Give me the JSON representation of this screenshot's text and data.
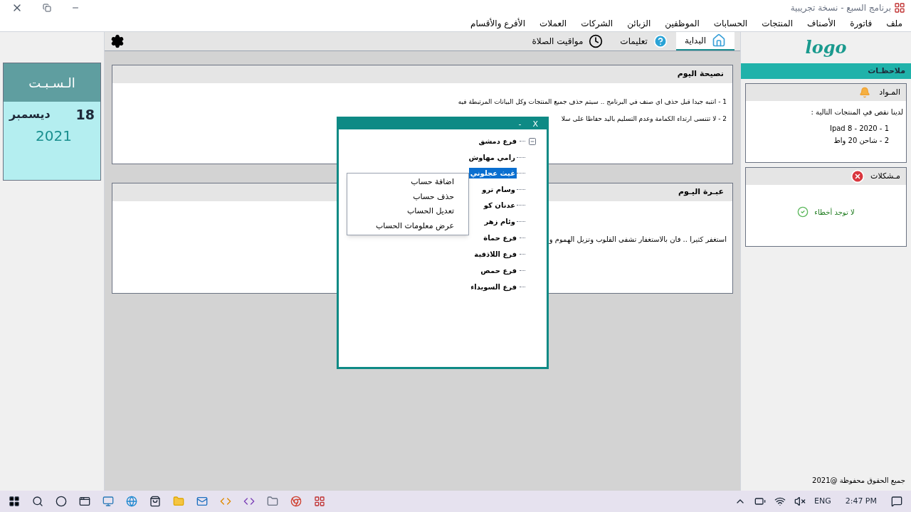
{
  "window": {
    "title": "برنامج السبع - نسخة تجريبية"
  },
  "menu": [
    "ملف",
    "فاتورة",
    "الأصناف",
    "المنتجات",
    "الحسابات",
    "الموظفين",
    "الزبائن",
    "الشركات",
    "العملات",
    "الأفرع والأقسام"
  ],
  "tabs": [
    {
      "label": "البداية",
      "selected": true,
      "kind": "home"
    },
    {
      "label": "تعليمات",
      "selected": false,
      "kind": "help"
    },
    {
      "label": "مواقيت الصلاة",
      "selected": false,
      "kind": "clock"
    }
  ],
  "date": {
    "weekday": "الـسـبـت",
    "day": "18",
    "month": "ديسمبر",
    "year": "2021"
  },
  "advice": {
    "title": "نصيحة اليوم",
    "lines": [
      "1 - انتبه جيدا قبل حذف اي صنف في البرنامج .. سيتم حذف جميع المنتجات وكل البيانات المرتبطة فيه",
      "2 - لا تتنسى ارتداء الكمامة وعدم التسليم باليد حفاظا على سلا"
    ]
  },
  "quote": {
    "title": "عبـرة اليـوم",
    "text": "استغفر كثيرا .. فان بالاستغفار تشفى القلوب وتزيل الهموم و"
  },
  "logo": "logo",
  "notes": {
    "title": "ملاحظـات",
    "materials": {
      "title": "المـواد",
      "intro": "لدينا نقص في المنتجات التالية :",
      "items": [
        "Ipad 8 - 2020 - 1",
        "2 - شاحن 20 واط"
      ]
    },
    "problems": {
      "title": "مـشكلات",
      "message": "لا توجد أخطاء"
    }
  },
  "footer": "جميع الحقوق محفوظة @2021",
  "dialog": {
    "minimize": "-",
    "close": "X",
    "tree": [
      {
        "label": "فرع دمشق",
        "expanded": true,
        "children": [
          {
            "label": "رامي مهاوش",
            "selected": false
          },
          {
            "label": "غيث عجلوني",
            "selected": true
          },
          {
            "label": "وسام ترو",
            "selected": false
          },
          {
            "label": "عدنان كو",
            "selected": false
          },
          {
            "label": "وئام زهر",
            "selected": false
          }
        ]
      },
      {
        "label": "فرع حماة"
      },
      {
        "label": "فرع اللاذقية"
      },
      {
        "label": "فرع حمص"
      },
      {
        "label": "فرع السويداء"
      }
    ]
  },
  "context_menu": [
    "اضافة حساب",
    "حذف حساب",
    "تعديل الحساب",
    "عرض معلومات الحساب"
  ],
  "taskbar": {
    "language": "ENG",
    "time": "2:47 PM"
  }
}
